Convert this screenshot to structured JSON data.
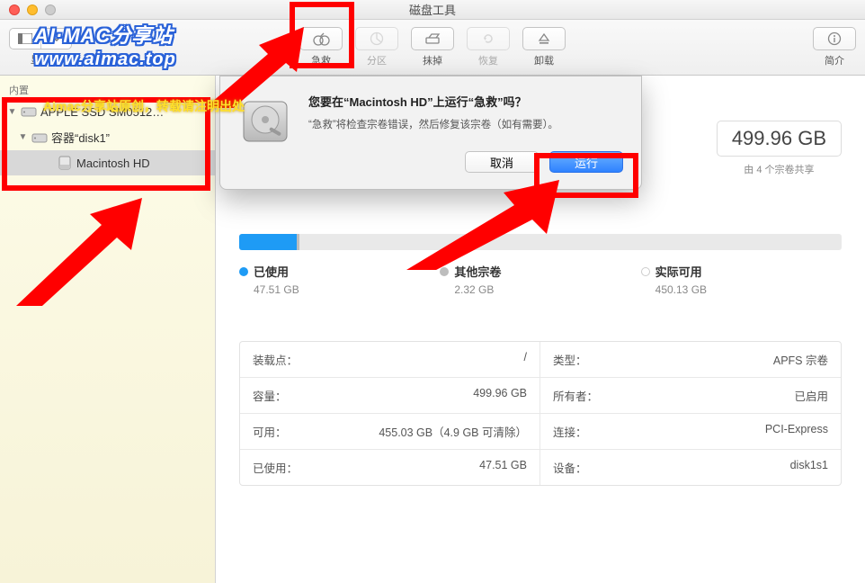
{
  "window": {
    "title": "磁盘工具"
  },
  "toolbar": {
    "view_label": "显示",
    "buttons": [
      {
        "id": "first-aid",
        "label": "急救"
      },
      {
        "id": "partition",
        "label": "分区",
        "disabled": true
      },
      {
        "id": "erase",
        "label": "抹掉"
      },
      {
        "id": "restore",
        "label": "恢复",
        "disabled": true
      },
      {
        "id": "unmount",
        "label": "卸载"
      }
    ],
    "info_label": "简介"
  },
  "sidebar": {
    "section": "内置",
    "items": [
      {
        "label": "APPLE SSD SM0512…",
        "level": 1,
        "expandable": true,
        "expanded": true,
        "icon": "disk"
      },
      {
        "label": "容器“disk1”",
        "level": 2,
        "expandable": true,
        "expanded": true,
        "icon": "disk"
      },
      {
        "label": "Macintosh HD",
        "level": 3,
        "expandable": false,
        "icon": "vol",
        "selected": true
      }
    ]
  },
  "capacity": {
    "value": "499.96 GB",
    "sub": "由 4 个宗卷共享"
  },
  "usage": {
    "segments": [
      {
        "pct": 9.5,
        "cls": "seg1"
      },
      {
        "pct": 0.5,
        "cls": "seg2"
      }
    ],
    "legend": [
      {
        "name": "已使用",
        "value": "47.51 GB",
        "color": "c-blue"
      },
      {
        "name": "其他宗卷",
        "value": "2.32 GB",
        "color": "c-gray"
      },
      {
        "name": "实际可用",
        "value": "450.13 GB",
        "color": "c-white"
      }
    ]
  },
  "info": [
    {
      "k": "装载点：",
      "v": "/"
    },
    {
      "k": "类型：",
      "v": "APFS 宗卷"
    },
    {
      "k": "容量：",
      "v": "499.96 GB"
    },
    {
      "k": "所有者：",
      "v": "已启用"
    },
    {
      "k": "可用：",
      "v": "455.03 GB（4.9 GB 可清除）"
    },
    {
      "k": "连接：",
      "v": "PCI-Express"
    },
    {
      "k": "已使用：",
      "v": "47.51 GB"
    },
    {
      "k": "设备：",
      "v": "disk1s1"
    }
  ],
  "dialog": {
    "title": "您要在“Macintosh HD”上运行“急救”吗？",
    "msg": "“急救”将检查宗卷错误，然后修复该宗卷（如有需要）。",
    "cancel": "取消",
    "run": "运行"
  },
  "watermark": {
    "l1": "AI·MAC分享站",
    "l2": "www.aimac.top",
    "note": "Aimac分享站原创，转载请注明出处"
  }
}
